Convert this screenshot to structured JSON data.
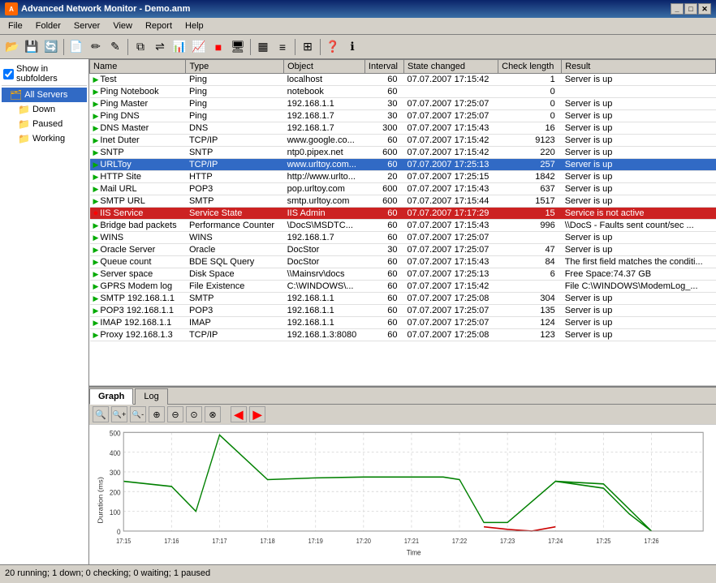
{
  "titlebar": {
    "title": "Advanced Network Monitor - Demo.anm",
    "icon": "ANM",
    "buttons": [
      "_",
      "□",
      "✕"
    ]
  },
  "menubar": {
    "items": [
      "File",
      "Folder",
      "Server",
      "View",
      "Report",
      "Help"
    ]
  },
  "sidebar": {
    "show_subfolders_label": "Show in subfolders",
    "items": [
      {
        "label": "All Servers",
        "type": "root",
        "selected": true
      },
      {
        "label": "Down",
        "type": "folder"
      },
      {
        "label": "Paused",
        "type": "folder"
      },
      {
        "label": "Working",
        "type": "folder"
      }
    ]
  },
  "table": {
    "columns": [
      "Name",
      "Type",
      "Object",
      "Interval",
      "State changed",
      "Check length",
      "Result"
    ],
    "rows": [
      {
        "name": "Test",
        "type": "Ping",
        "object": "localhost",
        "interval": "60",
        "state_changed": "07.07.2007 17:15:42",
        "check_length": "1",
        "result": "Server is up",
        "style": "normal"
      },
      {
        "name": "Ping Notebook",
        "type": "Ping",
        "object": "notebook",
        "interval": "60",
        "state_changed": "",
        "check_length": "0",
        "result": "",
        "style": "normal"
      },
      {
        "name": "Ping Master",
        "type": "Ping",
        "object": "192.168.1.1",
        "interval": "30",
        "state_changed": "07.07.2007 17:25:07",
        "check_length": "0",
        "result": "Server is up",
        "style": "normal"
      },
      {
        "name": "Ping DNS",
        "type": "Ping",
        "object": "192.168.1.7",
        "interval": "30",
        "state_changed": "07.07.2007 17:25:07",
        "check_length": "0",
        "result": "Server is up",
        "style": "normal"
      },
      {
        "name": "DNS Master",
        "type": "DNS",
        "object": "192.168.1.7",
        "interval": "300",
        "state_changed": "07.07.2007 17:15:43",
        "check_length": "16",
        "result": "Server is up",
        "style": "normal"
      },
      {
        "name": "Inet Duter",
        "type": "TCP/IP",
        "object": "www.google.co...",
        "interval": "60",
        "state_changed": "07.07.2007 17:15:42",
        "check_length": "9123",
        "result": "Server is up",
        "style": "normal"
      },
      {
        "name": "SNTP",
        "type": "SNTP",
        "object": "ntp0.pipex.net",
        "interval": "600",
        "state_changed": "07.07.2007 17:15:42",
        "check_length": "220",
        "result": "Server is up",
        "style": "normal"
      },
      {
        "name": "URLToy",
        "type": "TCP/IP",
        "object": "www.urltoy.com...",
        "interval": "60",
        "state_changed": "07.07.2007 17:25:13",
        "check_length": "257",
        "result": "Server is up",
        "style": "selected"
      },
      {
        "name": "HTTP Site",
        "type": "HTTP",
        "object": "http://www.urlto...",
        "interval": "20",
        "state_changed": "07.07.2007 17:25:15",
        "check_length": "1842",
        "result": "Server is up",
        "style": "normal"
      },
      {
        "name": "Mail URL",
        "type": "POP3",
        "object": "pop.urltoy.com",
        "interval": "600",
        "state_changed": "07.07.2007 17:15:43",
        "check_length": "637",
        "result": "Server is up",
        "style": "normal"
      },
      {
        "name": "SMTP URL",
        "type": "SMTP",
        "object": "smtp.urltoy.com",
        "interval": "600",
        "state_changed": "07.07.2007 17:15:44",
        "check_length": "1517",
        "result": "Server is up",
        "style": "normal"
      },
      {
        "name": "IIS Service",
        "type": "Service State",
        "object": "IIS Admin",
        "interval": "60",
        "state_changed": "07.07.2007 17:17:29",
        "check_length": "15",
        "result": "Service is not active",
        "style": "error"
      },
      {
        "name": "Bridge bad packets",
        "type": "Performance Counter",
        "object": "\\DocS\\MSDTC...",
        "interval": "60",
        "state_changed": "07.07.2007 17:15:43",
        "check_length": "996",
        "result": "\\\\DocS - Faults sent count/sec ...",
        "style": "normal"
      },
      {
        "name": "WINS",
        "type": "WINS",
        "object": "192.168.1.7",
        "interval": "60",
        "state_changed": "07.07.2007 17:25:07",
        "check_length": "",
        "result": "Server is up",
        "style": "normal"
      },
      {
        "name": "Oracle Server",
        "type": "Oracle",
        "object": "DocStor",
        "interval": "30",
        "state_changed": "07.07.2007 17:25:07",
        "check_length": "47",
        "result": "Server is up",
        "style": "normal"
      },
      {
        "name": "Queue count",
        "type": "BDE SQL Query",
        "object": "DocStor",
        "interval": "60",
        "state_changed": "07.07.2007 17:15:43",
        "check_length": "84",
        "result": "The first field matches the conditi...",
        "style": "normal"
      },
      {
        "name": "Server space",
        "type": "Disk Space",
        "object": "\\\\Mainsrv\\docs",
        "interval": "60",
        "state_changed": "07.07.2007 17:25:13",
        "check_length": "6",
        "result": "Free Space:74.37 GB",
        "style": "normal"
      },
      {
        "name": "GPRS Modem log",
        "type": "File Existence",
        "object": "C:\\WINDOWS\\...",
        "interval": "60",
        "state_changed": "07.07.2007 17:15:42",
        "check_length": "",
        "result": "File C:\\WINDOWS\\ModemLog_...",
        "style": "normal"
      },
      {
        "name": "SMTP 192.168.1.1",
        "type": "SMTP",
        "object": "192.168.1.1",
        "interval": "60",
        "state_changed": "07.07.2007 17:25:08",
        "check_length": "304",
        "result": "Server is up",
        "style": "normal"
      },
      {
        "name": "POP3 192.168.1.1",
        "type": "POP3",
        "object": "192.168.1.1",
        "interval": "60",
        "state_changed": "07.07.2007 17:25:07",
        "check_length": "135",
        "result": "Server is up",
        "style": "normal"
      },
      {
        "name": "IMAP 192.168.1.1",
        "type": "IMAP",
        "object": "192.168.1.1",
        "interval": "60",
        "state_changed": "07.07.2007 17:25:07",
        "check_length": "124",
        "result": "Server is up",
        "style": "normal"
      },
      {
        "name": "Proxy 192.168.1.3",
        "type": "TCP/IP",
        "object": "192.168.1.3:8080",
        "interval": "60",
        "state_changed": "07.07.2007 17:25:08",
        "check_length": "123",
        "result": "Server is up",
        "style": "normal"
      }
    ]
  },
  "bottom": {
    "tabs": [
      "Graph",
      "Log"
    ],
    "active_tab": "Graph",
    "graph": {
      "y_label": "Duration (ms)",
      "x_label": "Time",
      "y_ticks": [
        "500",
        "400",
        "300",
        "200",
        "100",
        "0"
      ],
      "x_ticks": [
        "17:16",
        "17:17",
        "17:18",
        "17:19",
        "17:20",
        "17:21",
        "17:22",
        "17:23",
        "17:24",
        "17:25",
        "17:26"
      ],
      "x_ticks_full": [
        "17:15",
        "17:16",
        "17:17",
        "17:18",
        "17:19",
        "17:20",
        "17:21",
        "17:22",
        "17:23",
        "17:24",
        "17:25",
        "17:26"
      ]
    }
  },
  "statusbar": {
    "text": "20 running; 1 down; 0 checking; 0 waiting; 1 paused"
  },
  "colors": {
    "selected_row": "#316ac5",
    "error_row": "#cc0000",
    "green_row": "#90ee90",
    "graph_green": "#008000",
    "graph_red": "#cc0000",
    "accent": "#0a246a"
  }
}
